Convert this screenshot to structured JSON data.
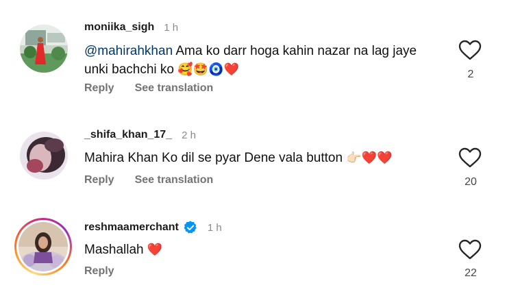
{
  "comments": [
    {
      "username": "moniika_sigh",
      "time": "1 h",
      "mention": "@mahirahkhan",
      "text": " Ama ko darr hoga kahin nazar na lag jaye unki bachchi ko ",
      "emojis": "🥰🤩🧿❤️",
      "reply": "Reply",
      "translate": "See translation",
      "likes": "2"
    },
    {
      "username": "_shifa_khan_17_",
      "time": "2 h",
      "text": "Mahira Khan Ko dil se pyar Dene vala button ",
      "emojis": "👉🏻❤️❤️",
      "reply": "Reply",
      "translate": "See translation",
      "likes": "20"
    },
    {
      "username": "reshmaamerchant",
      "time": "1 h",
      "verified": true,
      "text": "Mashallah ",
      "emojis": "❤️",
      "reply": "Reply",
      "likes": "22"
    }
  ],
  "icons": {
    "like": "heart-outline-icon",
    "verified": "verified-badge-icon"
  },
  "colors": {
    "mention": "#00376b",
    "secondary_text": "#737373",
    "verified": "#0095f6",
    "heart_emoji": "#e0252c"
  }
}
